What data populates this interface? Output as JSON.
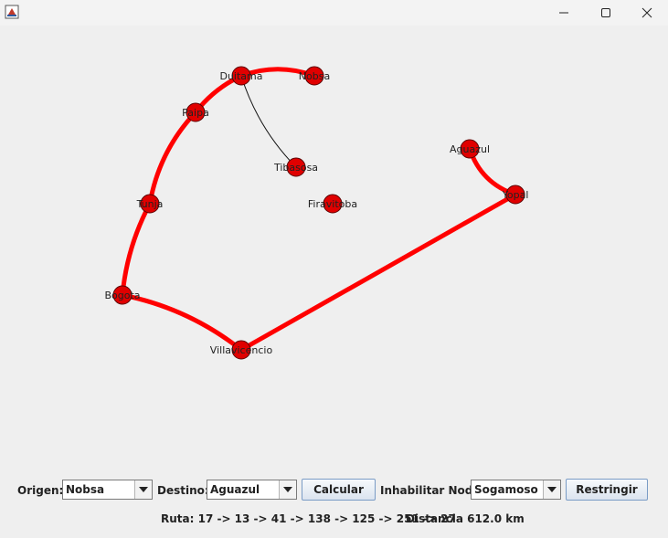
{
  "window": {
    "controls": {
      "minimize_icon": "minimize-icon",
      "maximize_icon": "maximize-icon",
      "close_icon": "close-icon"
    }
  },
  "graph": {
    "route_color": "#ff0000",
    "node_color": "#e00000",
    "nodes": [
      {
        "id": "duitama",
        "label": "Duitama"
      },
      {
        "id": "nobsa",
        "label": "Nobsa"
      },
      {
        "id": "paipa",
        "label": "Paipa"
      },
      {
        "id": "tibasosa",
        "label": "Tibasosa"
      },
      {
        "id": "aguazul",
        "label": "Aguazul"
      },
      {
        "id": "tunja",
        "label": "Tunja"
      },
      {
        "id": "firavitoba",
        "label": "Firavitoba"
      },
      {
        "id": "yopal",
        "label": "Yopal"
      },
      {
        "id": "bogota",
        "label": "Bogota"
      },
      {
        "id": "villavicencio",
        "label": "Villavicencio"
      }
    ],
    "edges": [
      {
        "from": "nobsa",
        "to": "duitama",
        "highlighted": true
      },
      {
        "from": "duitama",
        "to": "paipa",
        "highlighted": true
      },
      {
        "from": "paipa",
        "to": "tunja",
        "highlighted": true
      },
      {
        "from": "tunja",
        "to": "bogota",
        "highlighted": true
      },
      {
        "from": "bogota",
        "to": "villavicencio",
        "highlighted": true
      },
      {
        "from": "villavicencio",
        "to": "yopal",
        "highlighted": true
      },
      {
        "from": "yopal",
        "to": "aguazul",
        "highlighted": true
      },
      {
        "from": "duitama",
        "to": "tibasosa",
        "highlighted": false
      }
    ]
  },
  "controls": {
    "origen_label": "Origen:",
    "origen_value": "Nobsa",
    "destino_label": "Destino:",
    "destino_value": "Aguazul",
    "calcular_label": "Calcular",
    "inhabilitar_label": "Inhabilitar Nodo:",
    "inhabilitar_value": "Sogamoso",
    "restringir_label": "Restringir"
  },
  "status": {
    "ruta": "Ruta: 17 -> 13 -> 41 -> 138 -> 125 -> 251 -> 27",
    "distancia": "Distancia 612.0 km"
  }
}
